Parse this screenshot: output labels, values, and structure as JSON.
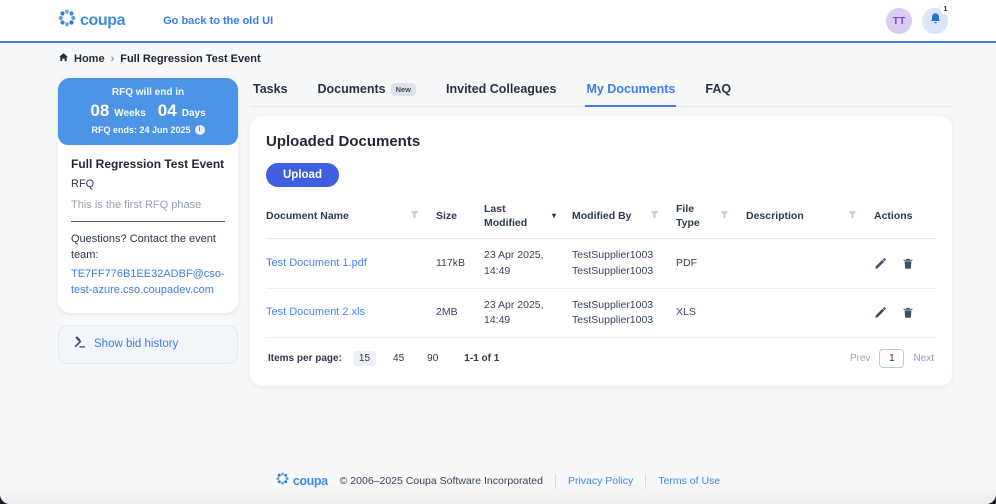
{
  "header": {
    "logo_text": "coupa",
    "back_link": "Go back to the old UI",
    "avatar_initials": "TT",
    "notification_count": "1"
  },
  "breadcrumb": {
    "home": "Home",
    "separator": "›",
    "current": "Full Regression Test Event"
  },
  "sidebar": {
    "countdown": {
      "title": "RFQ will end in",
      "weeks_value": "08",
      "weeks_label": "Weeks",
      "days_value": "04",
      "days_label": "Days",
      "ends_text": "RFQ ends: 24 Jun 2025",
      "info": "i"
    },
    "event_title": "Full Regression Test Event",
    "event_type": "RFQ",
    "phase_note": "This is the first RFQ phase",
    "contact_label": "Questions? Contact the event team:",
    "contact_email": "TE7FF776B1EE32ADBF@cso-test-azure.cso.coupadev.com",
    "bid_history_label": "Show bid history"
  },
  "tabs": [
    {
      "label": "Tasks"
    },
    {
      "label": "Documents",
      "badge": "New"
    },
    {
      "label": "Invited Colleagues"
    },
    {
      "label": "My Documents"
    },
    {
      "label": "FAQ"
    }
  ],
  "main": {
    "title": "Uploaded Documents",
    "upload_button": "Upload",
    "table": {
      "headers": [
        "Document Name",
        "Size",
        "Last Modified",
        "Modified By",
        "File Type",
        "Description",
        "Actions"
      ],
      "sort_caret": "▾",
      "rows": [
        {
          "name": "Test Document 1.pdf",
          "size": "117kB",
          "modified_line1": "23 Apr 2025,",
          "modified_line2": "14:49",
          "by_line1": "TestSupplier1003",
          "by_line2": "TestSupplier1003",
          "file_type": "PDF",
          "description": ""
        },
        {
          "name": "Test Document 2.xls",
          "size": "2MB",
          "modified_line1": "23 Apr 2025,",
          "modified_line2": "14:49",
          "by_line1": "TestSupplier1003",
          "by_line2": "TestSupplier1003",
          "file_type": "XLS",
          "description": ""
        }
      ]
    },
    "pagination": {
      "items_label": "Items per page:",
      "options": [
        "15",
        "45",
        "90"
      ],
      "selected": "15",
      "range": "1-1 of 1",
      "prev": "Prev",
      "page": "1",
      "next": "Next"
    }
  },
  "footer": {
    "logo_text": "coupa",
    "copyright": "© 2006–2025 Coupa Software Incorporated",
    "privacy": "Privacy Policy",
    "terms": "Terms of Use"
  },
  "colors": {
    "brand-blue": "#3e8ddd",
    "accent-blue": "#3b7cf0",
    "countdown-blue": "#4b94e6",
    "button-blue": "#3d5fe0",
    "link-blue": "#4285f4",
    "avatar-purple-bg": "#ddccf5",
    "avatar-purple-text": "#7a48d6",
    "bell-bg": "#d9e7f8",
    "bell-blue": "#2e6fd8"
  }
}
